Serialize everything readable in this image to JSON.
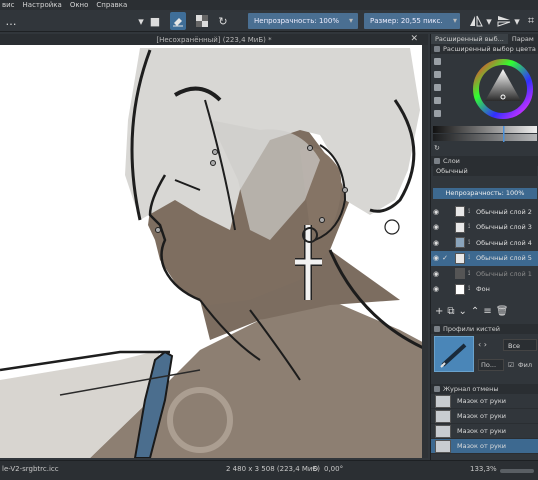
{
  "menubar": {
    "items": [
      "вис",
      "Настройка",
      "Окно",
      "Справка"
    ]
  },
  "toolbar": {
    "opacity_label": "Непрозрачность: 100%",
    "size_label": "Размер: 20,55 пикс.",
    "eraser_icon": "eraser-icon",
    "alpha_icon": "checker-icon",
    "reload_icon": "reload-icon"
  },
  "document": {
    "title": "[Несохранённый]  (223,4 МиБ) *",
    "close": "✕"
  },
  "dock": {
    "tabs": [
      "Расширенный выб...",
      "Парам"
    ],
    "color_panel_title": "Расширенный выбор цвета",
    "layers_panel_title": "Слои",
    "blend_mode": "Обычный",
    "layer_opacity": "Непрозрачность:  100%",
    "layers": [
      {
        "name": "Обычный слой 2",
        "visible": true,
        "selected": false,
        "dim": false,
        "check": ""
      },
      {
        "name": "Обычный слой 3",
        "visible": true,
        "selected": false,
        "dim": false,
        "check": ""
      },
      {
        "name": "Обычный слой 4",
        "visible": true,
        "selected": false,
        "dim": false,
        "check": ""
      },
      {
        "name": "Обычный слой 5",
        "visible": true,
        "selected": true,
        "dim": false,
        "check": "✓"
      },
      {
        "name": "Обычный слой 1",
        "visible": true,
        "selected": false,
        "dim": true,
        "check": ""
      },
      {
        "name": "Фон",
        "visible": true,
        "selected": false,
        "dim": false,
        "check": ""
      }
    ],
    "brush_panel_title": "Профили кистей",
    "brush_filter": "Все",
    "brush_search_placeholder": "По...",
    "brush_filter_check": "Фил",
    "history_panel_title": "Журнал отмены",
    "history": [
      {
        "label": "Мазок от руки",
        "selected": false
      },
      {
        "label": "Мазок от руки",
        "selected": false
      },
      {
        "label": "Мазок от руки",
        "selected": false
      },
      {
        "label": "Мазок от руки",
        "selected": true
      }
    ]
  },
  "statusbar": {
    "profile": "le-V2-srgbtrc.icc",
    "dimensions": "2 480 x 3 508 (223,4 МиБ)",
    "rotation": "0,00°",
    "zoom": "133,3%"
  },
  "colors": {
    "accent": "#3d6990",
    "panel_bg": "#31363b",
    "canvas_bg": "#ffffff",
    "skin": "#8a7a6c",
    "hair": "#d6d6d4",
    "strap": "#4b6e8e"
  }
}
